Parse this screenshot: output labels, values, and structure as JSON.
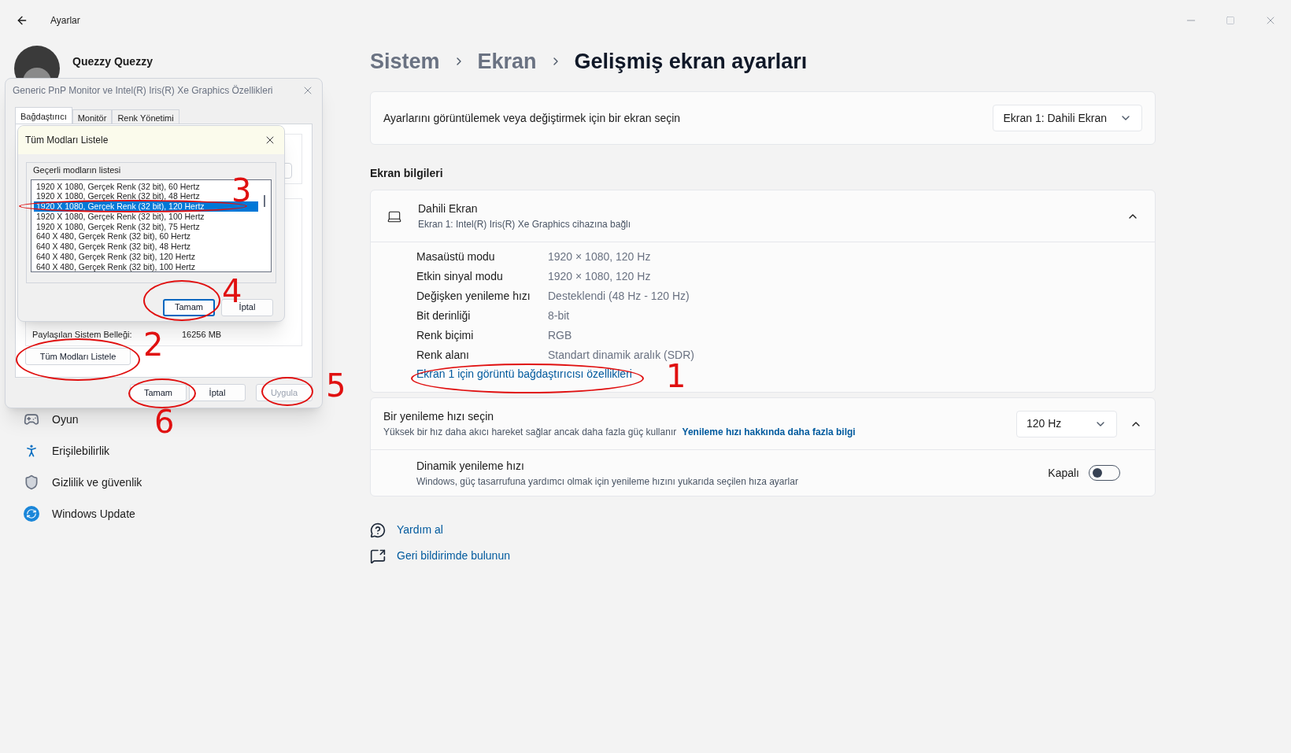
{
  "window": {
    "title": "Ayarlar"
  },
  "profile": {
    "name": "Quezzy Quezzy"
  },
  "sidebar": {
    "items": [
      {
        "label": "Oyun"
      },
      {
        "label": "Erişilebilirlik"
      },
      {
        "label": "Gizlilik ve güvenlik"
      },
      {
        "label": "Windows Update"
      }
    ]
  },
  "breadcrumb": [
    "Sistem",
    "Ekran",
    "Gelişmiş ekran ayarları"
  ],
  "display_select": {
    "label": "Ayarlarını görüntülemek veya değiştirmek için bir ekran seçin",
    "value": "Ekran 1: Dahili Ekran"
  },
  "display_info": {
    "heading": "Ekran bilgileri",
    "title": "Dahili Ekran",
    "subtitle": "Ekran 1: Intel(R) Iris(R) Xe Graphics cihazına bağlı",
    "expanded": true,
    "rows": [
      {
        "label": "Masaüstü modu",
        "value": "1920 × 1080, 120 Hz"
      },
      {
        "label": "Etkin sinyal modu",
        "value": "1920 × 1080, 120 Hz"
      },
      {
        "label": "Değişken yenileme hızı",
        "value": "Desteklendi (48 Hz - 120 Hz)"
      },
      {
        "label": "Bit derinliği",
        "value": "8-bit"
      },
      {
        "label": "Renk biçimi",
        "value": "RGB"
      },
      {
        "label": "Renk alanı",
        "value": "Standart dinamik aralık (SDR)"
      }
    ],
    "link": "Ekran 1 için görüntü bağdaştırıcısı özellikleri"
  },
  "refresh": {
    "title": "Bir yenileme hızı seçin",
    "description": "Yüksek bir hız daha akıcı hareket sağlar ancak daha fazla güç kullanır",
    "link": "Yenileme hızı hakkında daha fazla bilgi",
    "value": "120 Hz",
    "expanded": true,
    "dynamic": {
      "title": "Dinamik yenileme hızı",
      "description": "Windows, güç tasarrufuna yardımcı olmak için yenileme hızını yukarıda seçilen hıza ayarlar",
      "state_label": "Kapalı",
      "on": false
    }
  },
  "help_links": [
    "Yardım al",
    "Geri bildirimde bulunun"
  ],
  "properties_dialog": {
    "title": "Generic PnP Monitor ve Intel(R) Iris(R) Xe Graphics Özellikleri",
    "tabs": [
      {
        "label": "Bağdaştırıcı",
        "selected": true
      },
      {
        "label": "Monitör",
        "selected": false
      },
      {
        "label": "Renk Yönetimi",
        "selected": false
      }
    ],
    "shared_memory_label": "Paylaşılan Sistem Belleği:",
    "shared_memory_value": "16256 MB",
    "list_all_button": "Tüm Modları Listele",
    "buttons": [
      {
        "label": "Tamam",
        "disabled": false
      },
      {
        "label": "İptal",
        "disabled": false
      },
      {
        "label": "Uygula",
        "disabled": true
      }
    ]
  },
  "modes_dialog": {
    "title": "Tüm Modları Listele",
    "group_label": "Geçerli modların listesi",
    "modes": [
      {
        "label": "1920 X 1080, Gerçek Renk (32 bit), 60 Hertz",
        "selected": false
      },
      {
        "label": "1920 X 1080, Gerçek Renk (32 bit), 48 Hertz",
        "selected": false
      },
      {
        "label": "1920 X 1080, Gerçek Renk (32 bit), 120 Hertz",
        "selected": true
      },
      {
        "label": "1920 X 1080, Gerçek Renk (32 bit), 100 Hertz",
        "selected": false
      },
      {
        "label": "1920 X 1080, Gerçek Renk (32 bit), 75 Hertz",
        "selected": false
      },
      {
        "label": "640 X 480, Gerçek Renk (32 bit), 60 Hertz",
        "selected": false
      },
      {
        "label": "640 X 480, Gerçek Renk (32 bit), 48 Hertz",
        "selected": false
      },
      {
        "label": "640 X 480, Gerçek Renk (32 bit), 120 Hertz",
        "selected": false
      },
      {
        "label": "640 X 480, Gerçek Renk (32 bit), 100 Hertz",
        "selected": false
      }
    ],
    "buttons": [
      {
        "label": "Tamam",
        "default": true
      },
      {
        "label": "İptal",
        "default": false
      }
    ]
  },
  "annotations": [
    "1",
    "2",
    "3",
    "4",
    "5",
    "6"
  ]
}
